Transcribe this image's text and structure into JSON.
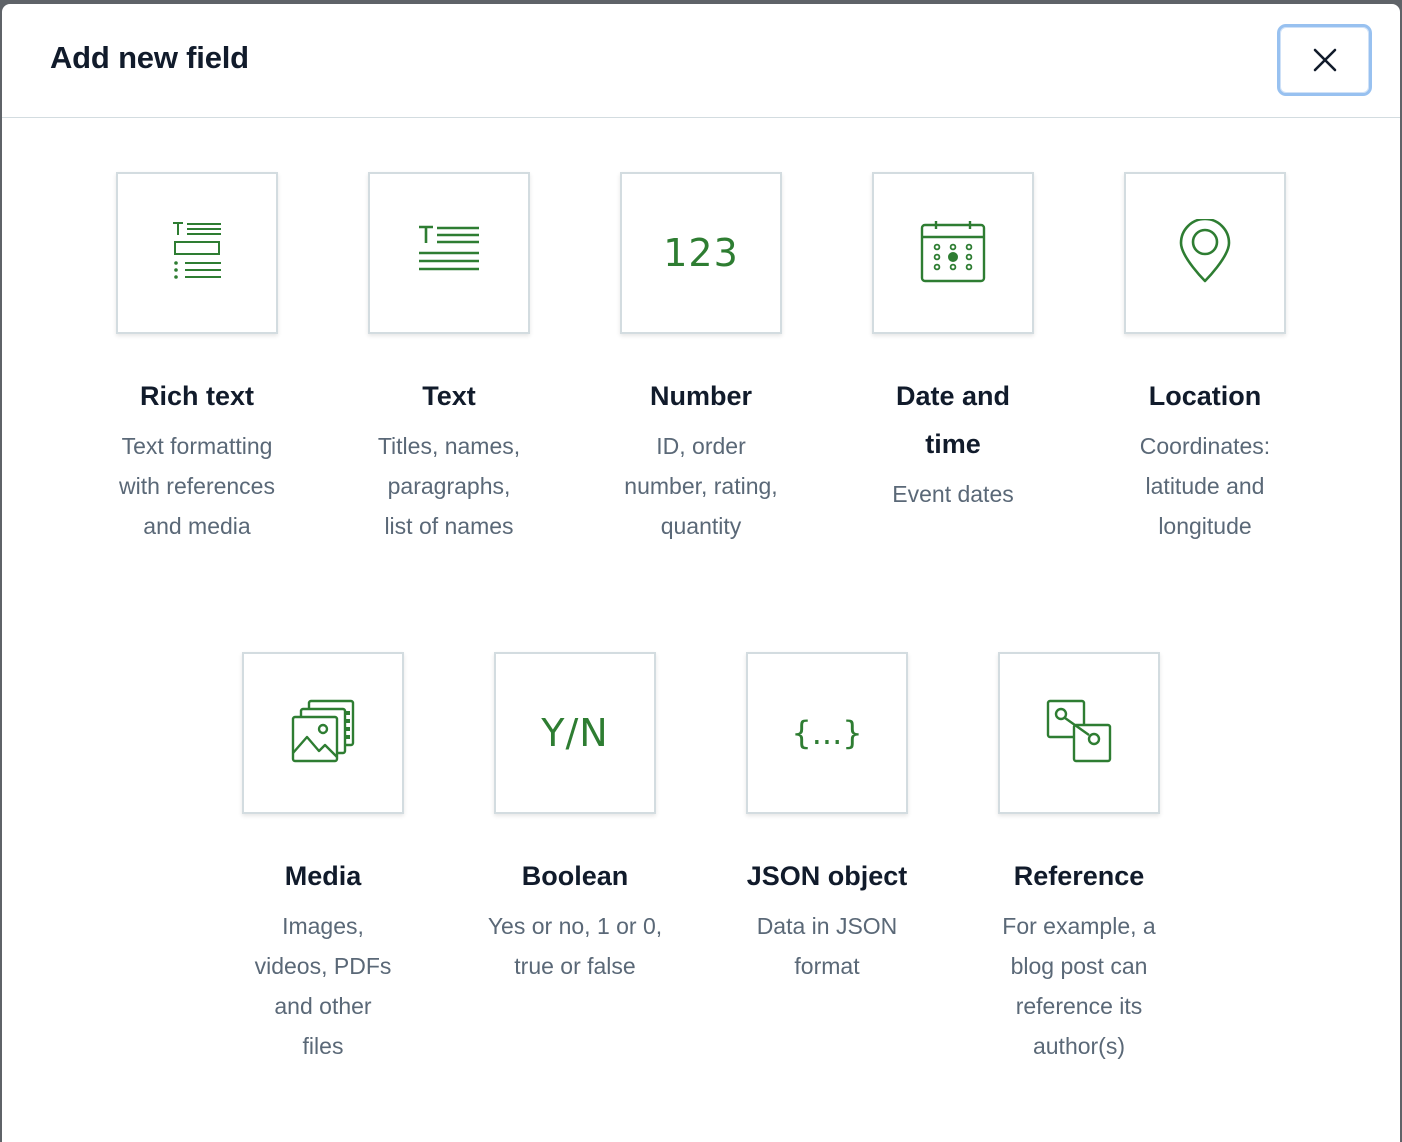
{
  "modal": {
    "title": "Add new field",
    "close_icon": "close-icon"
  },
  "accent_color": "#2e7d32",
  "fields_row1": [
    {
      "icon": "rich-text-icon",
      "title": "Rich text",
      "description": "Text formatting with references and media"
    },
    {
      "icon": "text-icon",
      "title": "Text",
      "description": "Titles, names, paragraphs, list of names"
    },
    {
      "icon": "number-icon",
      "icon_text": "123",
      "title": "Number",
      "description": "ID, order number, rating, quantity"
    },
    {
      "icon": "calendar-icon",
      "title": "Date and time",
      "description": "Event dates"
    },
    {
      "icon": "location-pin-icon",
      "title": "Location",
      "description": "Coordinates: latitude and longitude"
    }
  ],
  "fields_row2": [
    {
      "icon": "media-icon",
      "title": "Media",
      "description": "Images, videos, PDFs and other files"
    },
    {
      "icon": "boolean-icon",
      "icon_text": "Y/N",
      "title": "Boolean",
      "description": "Yes or no, 1 or 0, true or false"
    },
    {
      "icon": "json-icon",
      "icon_text": "{...}",
      "title": "JSON object",
      "description": "Data in JSON format"
    },
    {
      "icon": "reference-icon",
      "title": "Reference",
      "description": "For example, a blog post can reference its author(s)"
    }
  ]
}
